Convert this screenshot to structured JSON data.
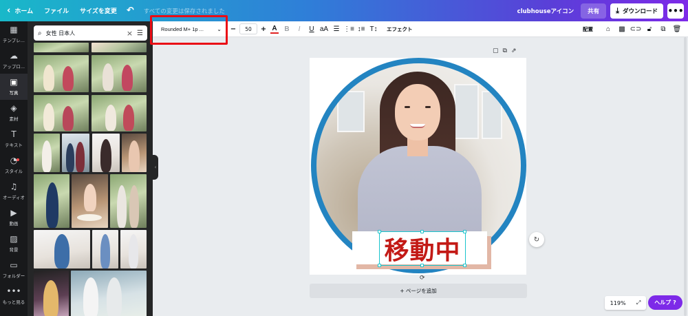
{
  "topbar": {
    "home_label": "ホーム",
    "file_label": "ファイル",
    "resize_label": "サイズを変更",
    "saved_status": "すべての変更は保存されました",
    "project_name": "clubhouseアイコン",
    "share_label": "共有",
    "download_label": "ダウンロード",
    "icons": {
      "back": "chevron-left-icon",
      "undo": "undo-icon",
      "download": "download-icon",
      "more": "more-horizontal-icon"
    }
  },
  "rail": {
    "items": [
      {
        "label": "テンプレ...",
        "icon": "template-icon"
      },
      {
        "label": "アップロ...",
        "icon": "upload-cloud-icon"
      },
      {
        "label": "写真",
        "icon": "photo-icon"
      },
      {
        "label": "素材",
        "icon": "elements-icon"
      },
      {
        "label": "テキスト",
        "icon": "text-icon"
      },
      {
        "label": "スタイル",
        "icon": "palette-icon"
      },
      {
        "label": "オーディオ",
        "icon": "music-icon"
      },
      {
        "label": "動画",
        "icon": "video-icon"
      },
      {
        "label": "背景",
        "icon": "background-icon"
      },
      {
        "label": "フォルダー",
        "icon": "folder-icon"
      },
      {
        "label": "もっと見る",
        "icon": "more-icon"
      }
    ],
    "active_index": 2
  },
  "panel": {
    "search": {
      "value": "女性 日本人",
      "placeholder": ""
    }
  },
  "toolbar": {
    "font_name": "Rounded M+ 1p ...",
    "font_size": "50",
    "effects_label": "エフェクト",
    "position_label": "配置",
    "text_color": "#e02121"
  },
  "canvas": {
    "banner_text": "移動中",
    "add_page_label": "+ ページを追加",
    "ring_color": "#2384c1",
    "banner_text_color": "#c31a16"
  },
  "footer": {
    "zoom": "119%",
    "help_label": "ヘルプ ?"
  }
}
